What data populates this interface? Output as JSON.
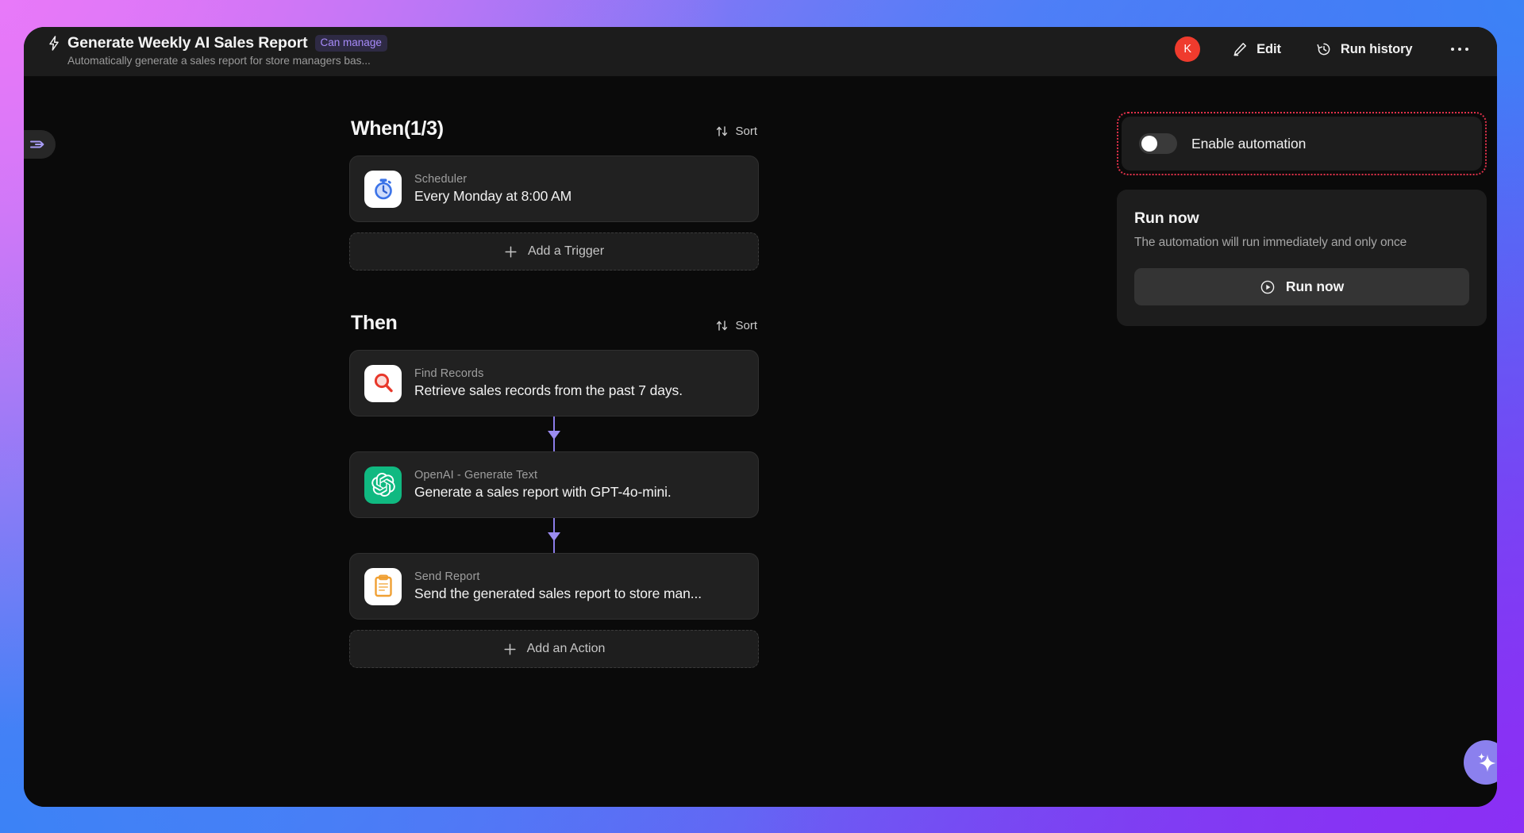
{
  "header": {
    "bolt_icon": "bolt-icon",
    "title": "Generate Weekly AI Sales Report",
    "badge": "Can manage",
    "subtitle": "Automatically generate a sales report for store managers bas...",
    "avatar_initial": "K",
    "edit_label": "Edit",
    "run_history_label": "Run history",
    "more_label": "more-options"
  },
  "sidebar_toggle": {
    "name": "expand-sidebar"
  },
  "flow": {
    "when": {
      "title": "When(1/3)",
      "sort_label": "Sort",
      "cards": [
        {
          "kicker": "Scheduler",
          "desc": "Every Monday at 8:00 AM",
          "icon": "stopwatch-icon"
        }
      ],
      "add_label": "Add a Trigger"
    },
    "then": {
      "title": "Then",
      "sort_label": "Sort",
      "cards": [
        {
          "kicker": "Find Records",
          "desc": "Retrieve sales records from the past 7 days.",
          "icon": "magnifier-icon"
        },
        {
          "kicker": "OpenAI - Generate Text",
          "desc": "Generate a sales report with GPT-4o-mini.",
          "icon": "openai-icon"
        },
        {
          "kicker": "Send Report",
          "desc": "Send the generated sales report to store man...",
          "icon": "clipboard-icon"
        }
      ],
      "add_label": "Add an Action"
    }
  },
  "right_panel": {
    "enable_label": "Enable automation",
    "enable_state": "off",
    "run_title": "Run now",
    "run_subtitle": "The automation will run immediately and only once",
    "run_button_label": "Run now"
  },
  "fab": {
    "name": "ai-assistant"
  },
  "colors": {
    "accent_purple": "#8b80ee",
    "badge_purple": "#a78bfa",
    "avatar_red": "#ef3b2d",
    "highlight_red": "#e0314a",
    "openai_green": "#10b981"
  }
}
